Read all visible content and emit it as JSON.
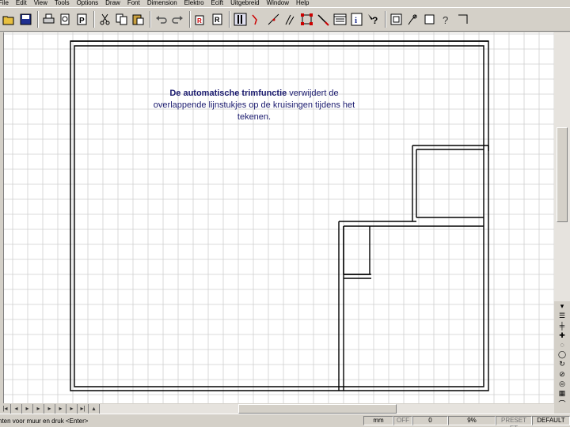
{
  "menu": {
    "items": [
      "File",
      "Edit",
      "View",
      "Tools",
      "Options",
      "Draw",
      "Font",
      "Dimension",
      "Elektro",
      "Ecift",
      "Uitgebreid",
      "Window",
      "Help"
    ]
  },
  "toolbar": {
    "buttons": [
      "open-icon",
      "save-icon",
      "print-icon",
      "print-preview-icon",
      "properties-icon",
      "cut-icon",
      "copy-icon",
      "paste-icon",
      "undo-icon",
      "redo-icon",
      "insert-block-icon",
      "reference-icon",
      "parallel-lines-icon",
      "angle-icon",
      "line-icon",
      "multi-line-icon",
      "select-points-icon",
      "trim-icon",
      "layers-icon",
      "info-icon",
      "whats-this-icon",
      "zoom-window-icon",
      "zoom-icon",
      "rectangle-icon",
      "help-icon",
      "snap-icon"
    ]
  },
  "canvas": {
    "annotation_bold": "De automatische trimfunctie",
    "annotation_rest": " verwijdert de overlappende lijnstukjes op de kruisingen tijdens het tekenen."
  },
  "statusbar": {
    "prompt": "nten voor muur en druk <Enter>",
    "units": "mm",
    "ortho": "OFF",
    "angle": "0",
    "zoom": "9%",
    "preset": "PRESET ET",
    "layer": "DEFAULT"
  },
  "colors": {
    "annotation_text": "#1a1a6e",
    "grid": "#cfcfcf",
    "wall": "#000000"
  }
}
